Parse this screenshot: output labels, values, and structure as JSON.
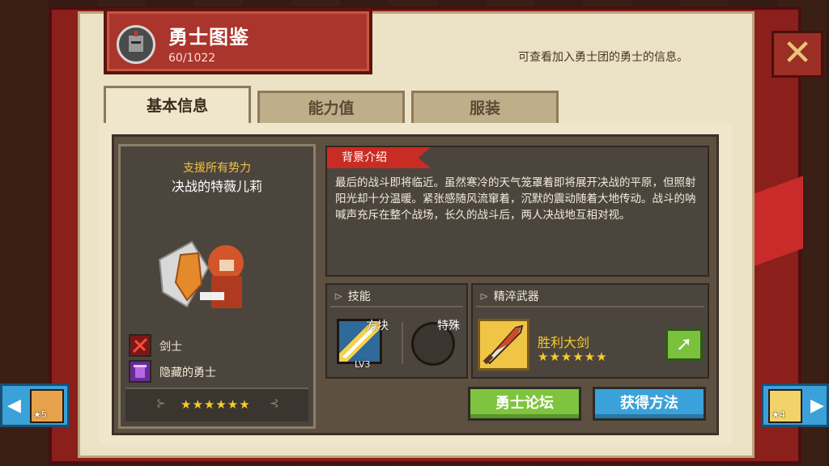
{
  "header": {
    "title": "勇士图鉴",
    "count": "60/1022",
    "description": "可查看加入勇士团的勇士的信息。",
    "close_glyph": "✕"
  },
  "tabs": [
    {
      "label": "基本信息",
      "active": true
    },
    {
      "label": "能力值",
      "active": false
    },
    {
      "label": "服装",
      "active": false
    }
  ],
  "hero": {
    "faction": "支援所有势力",
    "name": "决战的特薇儿莉",
    "class_label": "剑士",
    "tag_label": "隐藏的勇士",
    "stars": "★★★★★★"
  },
  "background": {
    "title": "背景介绍",
    "text": "最后的战斗即将临近。虽然寒冷的天气笼罩着即将展开决战的平原，但照射阳光却十分温暖。紧张感随风流窜着，沉默的震动随着大地传动。战斗的呐喊声充斥在整个战场，长久的战斗后，两人决战地互相对视。"
  },
  "skills": {
    "title": "技能",
    "skill1_name": "方块",
    "skill1_level": "LV3",
    "skill2_name": "特殊"
  },
  "weapon": {
    "title": "精淬武器",
    "name": "胜利大剑",
    "stars": "★★★★★★",
    "go_glyph": "➚"
  },
  "actions": {
    "forum_label": "勇士论坛",
    "obtain_label": "获得方法"
  },
  "nav": {
    "left_arrow": "◀",
    "left_star": "★5",
    "right_arrow": "▶",
    "right_star": "★4"
  },
  "colors": {
    "accent_red": "#c92c22",
    "star_gold": "#f4cc2c",
    "forum_green": "#7ec43e",
    "obtain_blue": "#3aa2d9"
  }
}
